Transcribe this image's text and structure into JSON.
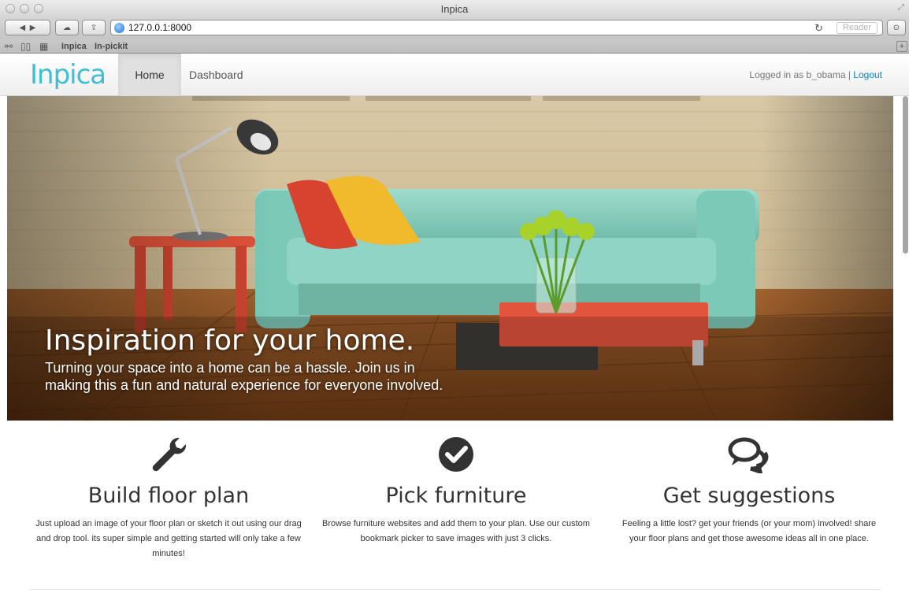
{
  "browser": {
    "window_title": "Inpica",
    "url": "127.0.0.1:8000",
    "reader_label": "Reader",
    "bookmarks": [
      "Inpica",
      "In-pickit"
    ]
  },
  "nav": {
    "brand": "Inpica",
    "items": [
      {
        "label": "Home",
        "active": true
      },
      {
        "label": "Dashboard",
        "active": false
      }
    ],
    "logged_in_text": "Logged in as b_obama |",
    "logout_label": "Logout"
  },
  "hero": {
    "title": "Inspiration for your home.",
    "subtitle": "Turning your space into a home can be a hassle. Join us in making this a fun and natural experience for everyone involved."
  },
  "features": [
    {
      "icon": "wrench-icon",
      "title": "Build floor plan",
      "description": "Just upload an image of your floor plan or sketch it out using our drag and drop tool. its super simple and getting started will only take a few minutes!"
    },
    {
      "icon": "check-circle-icon",
      "title": "Pick furniture",
      "description": "Browse furniture websites and add them to your plan. Use our custom bookmark picker to save images with just 3 clicks."
    },
    {
      "icon": "chat-bubbles-icon",
      "title": "Get suggestions",
      "description": "Feeling a little lost? get your friends (or your mom) involved! share your floor plans and get those awesome ideas all in one place."
    }
  ],
  "colors": {
    "brand": "#3dbfd8",
    "link": "#0088cc",
    "sofa": "#86cfbf",
    "floor": "#8a4b1f"
  }
}
